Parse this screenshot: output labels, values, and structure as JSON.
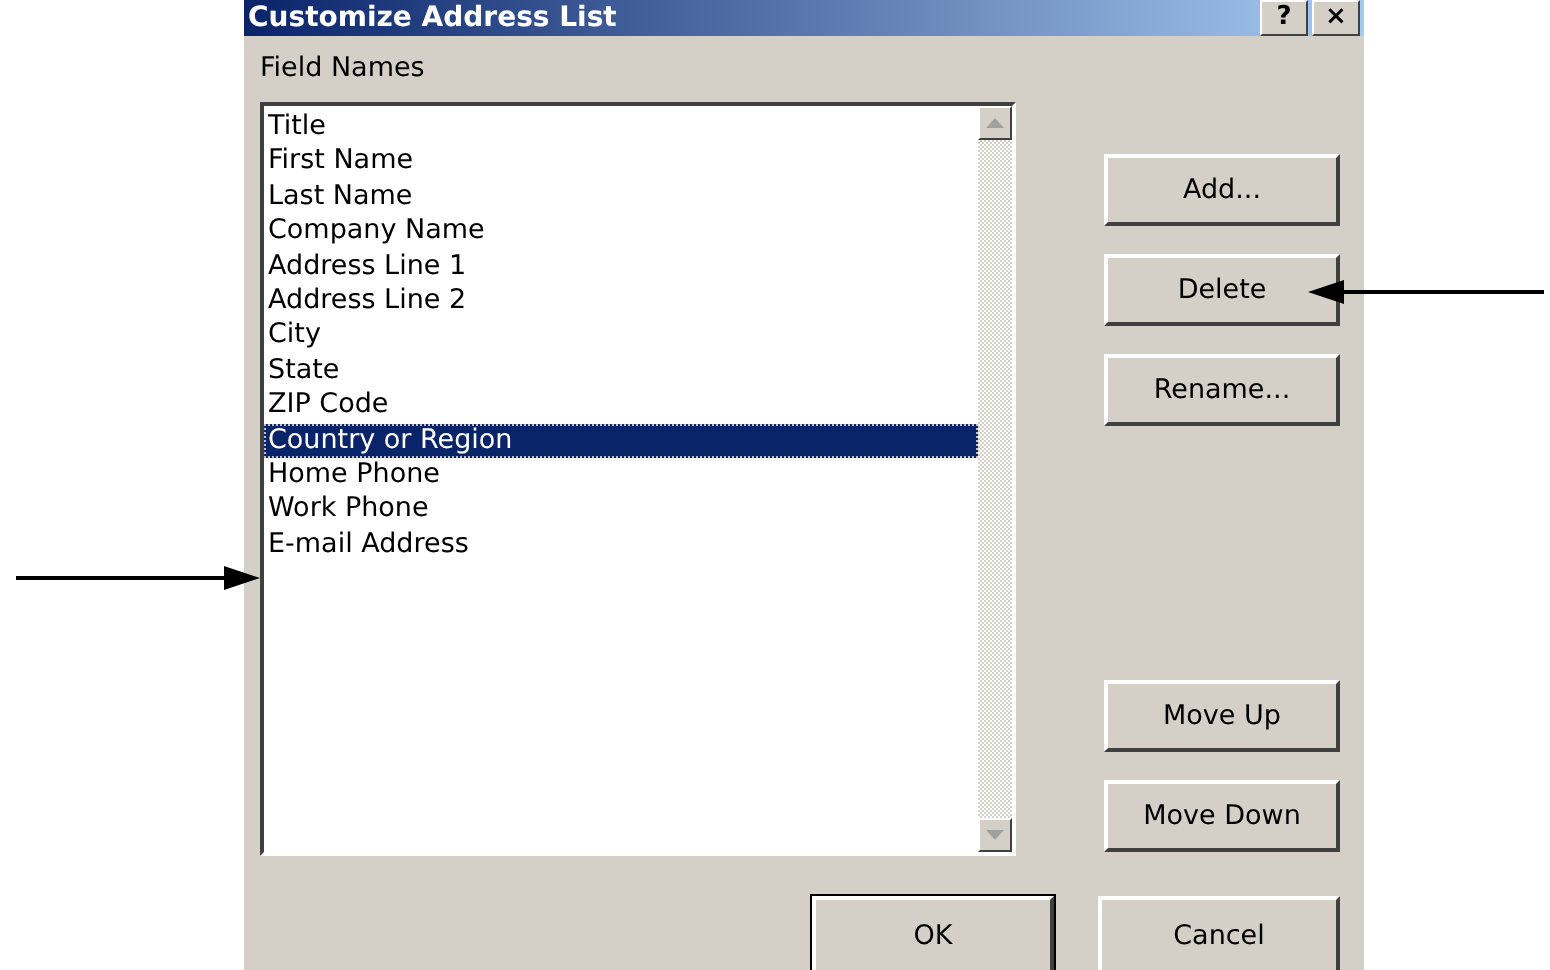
{
  "window": {
    "title": "Customize Address List",
    "help_button": "?",
    "close_button": "×"
  },
  "field_names": {
    "label": "Field Names",
    "items": [
      {
        "label": "Title",
        "selected": false
      },
      {
        "label": "First Name",
        "selected": false
      },
      {
        "label": "Last Name",
        "selected": false
      },
      {
        "label": "Company Name",
        "selected": false
      },
      {
        "label": "Address Line 1",
        "selected": false
      },
      {
        "label": "Address Line 2",
        "selected": false
      },
      {
        "label": "City",
        "selected": false
      },
      {
        "label": "State",
        "selected": false
      },
      {
        "label": "ZIP Code",
        "selected": false
      },
      {
        "label": "Country or Region",
        "selected": true
      },
      {
        "label": "Home Phone",
        "selected": false
      },
      {
        "label": "Work Phone",
        "selected": false
      },
      {
        "label": "E-mail Address",
        "selected": false
      }
    ]
  },
  "action_buttons": [
    {
      "label": "Add..."
    },
    {
      "label": "Delete"
    },
    {
      "label": "Rename..."
    }
  ],
  "move_buttons": [
    {
      "label": "Move Up"
    },
    {
      "label": "Move Down"
    }
  ],
  "footer_buttons": [
    {
      "label": "OK",
      "default": true
    },
    {
      "label": "Cancel",
      "default": false
    }
  ]
}
